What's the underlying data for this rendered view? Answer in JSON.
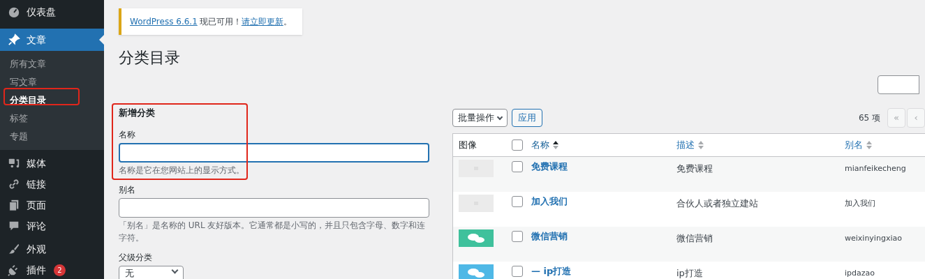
{
  "sidebar": {
    "items": [
      {
        "label": "仪表盘",
        "selected": false
      },
      {
        "label": "文章",
        "selected": true,
        "children": [
          {
            "label": "所有文章",
            "selected": false
          },
          {
            "label": "写文章",
            "selected": false
          },
          {
            "label": "分类目录",
            "selected": true
          },
          {
            "label": "标签",
            "selected": false
          },
          {
            "label": "专题",
            "selected": false
          }
        ]
      },
      {
        "label": "媒体",
        "selected": false
      },
      {
        "label": "链接",
        "selected": false
      },
      {
        "label": "页面",
        "selected": false
      },
      {
        "label": "评论",
        "selected": false
      },
      {
        "label": "外观",
        "selected": false
      },
      {
        "label": "插件",
        "selected": false,
        "badge": "2"
      }
    ]
  },
  "notice": {
    "link": "WordPress 6.6.1",
    "text": "现已可用！",
    "action": "请立即更新",
    "end": "。"
  },
  "title": "分类目录",
  "form": {
    "heading": "新增分类",
    "fields": [
      {
        "kind": "input",
        "label": "名称",
        "focused": true,
        "help": "名称是它在您网站上的显示方式。"
      },
      {
        "kind": "input",
        "label": "别名",
        "focused": false,
        "help": "「别名」是名称的 URL 友好版本。它通常都是小写的，并且只包含字母、数字和连字符。"
      },
      {
        "kind": "select",
        "label": "父级分类",
        "value": "无"
      }
    ]
  },
  "table": {
    "bulk_action": "批量操作",
    "apply": "应用",
    "count": "65 项",
    "pagination": [
      "«",
      "‹"
    ],
    "select_all_checked": false,
    "columns": [
      {
        "label": "图像",
        "sortable": false
      },
      {
        "label": "名称",
        "sortable": true,
        "sorted": true
      },
      {
        "label": "描述",
        "sortable": true,
        "sorted": false
      },
      {
        "label": "别名",
        "sortable": true,
        "sorted": false
      }
    ],
    "rows": [
      {
        "image": {
          "kind": "placeholder"
        },
        "checked": false,
        "name": "免费课程",
        "description": "免费课程",
        "slug": "mianfeikecheng"
      },
      {
        "image": {
          "kind": "placeholder"
        },
        "checked": false,
        "name": "加入我们",
        "description": "合伙人或者独立建站",
        "slug": "加入我们"
      },
      {
        "image": {
          "kind": "chat",
          "color": "#3fc19c"
        },
        "checked": false,
        "name": "微信营销",
        "description": "微信营销",
        "slug": "weixinyingxiao"
      },
      {
        "image": {
          "kind": "chat",
          "color": "#4fb8e6"
        },
        "checked": false,
        "name": "— ip打造",
        "description": "ip打造",
        "slug": "ipdazao"
      }
    ]
  }
}
